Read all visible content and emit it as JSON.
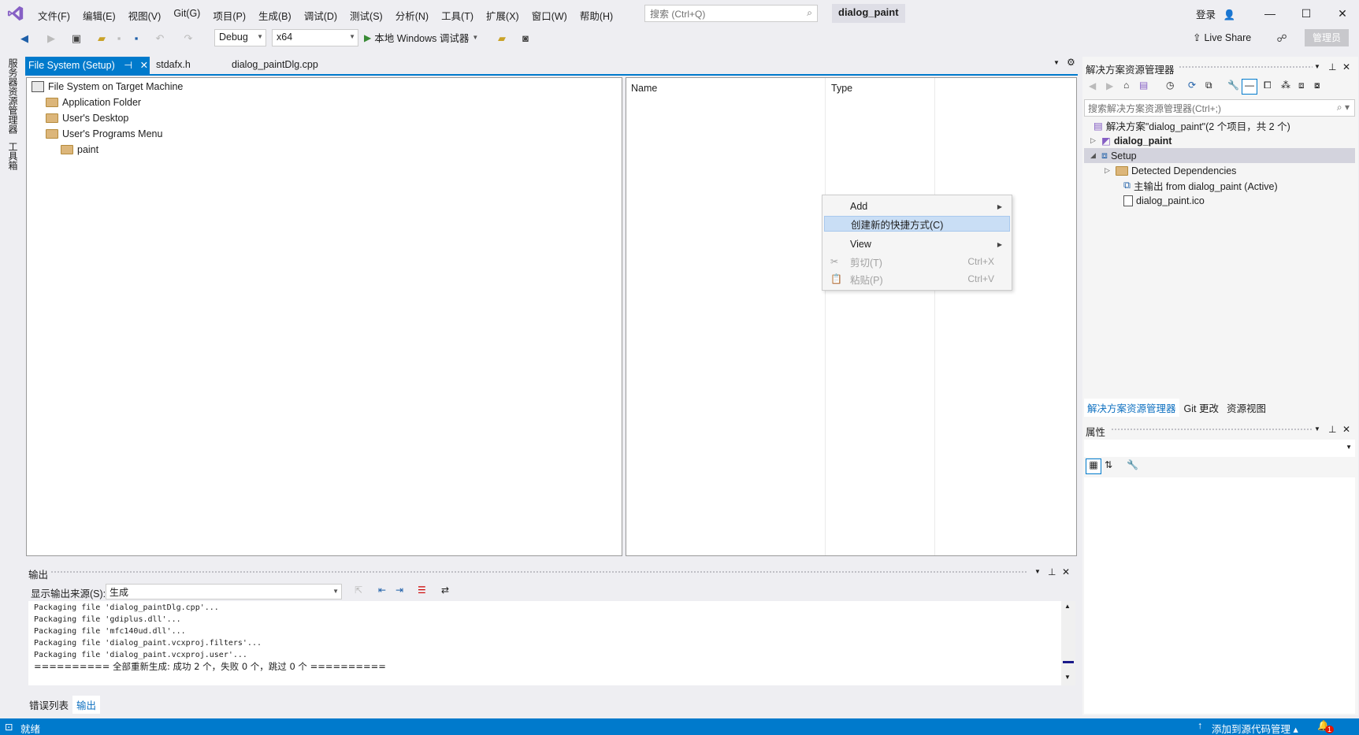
{
  "menu": {
    "items": [
      "文件(F)",
      "编辑(E)",
      "视图(V)",
      "Git(G)",
      "项目(P)",
      "生成(B)",
      "调试(D)",
      "测试(S)",
      "分析(N)",
      "工具(T)",
      "扩展(X)",
      "窗口(W)",
      "帮助(H)"
    ],
    "search_placeholder": "搜索 (Ctrl+Q)",
    "solution_name": "dialog_paint",
    "login": "登录"
  },
  "toolbar": {
    "config": "Debug",
    "platform": "x64",
    "run_label": "本地 Windows 调试器",
    "live_share": "Live Share",
    "admin": "管理员"
  },
  "left_strip": {
    "tab1": "服务器资源管理器",
    "tab2": "工具箱"
  },
  "doc_tabs": [
    "File System (Setup)",
    "stdafx.h",
    "dialog_paintDlg.cpp"
  ],
  "filesystem": {
    "root": "File System on Target Machine",
    "items": [
      "Application Folder",
      "User's Desktop",
      "User's Programs Menu"
    ],
    "subitem": "paint",
    "col_name": "Name",
    "col_type": "Type"
  },
  "context_menu": {
    "add": "Add",
    "create_shortcut": "创建新的快捷方式(C)",
    "view": "View",
    "cut": "剪切(T)",
    "cut_shortcut": "Ctrl+X",
    "paste": "粘贴(P)",
    "paste_shortcut": "Ctrl+V"
  },
  "output": {
    "title": "输出",
    "source_label": "显示输出来源(S):",
    "source_value": "生成",
    "lines": [
      "Packaging file 'dialog_paintDlg.cpp'...",
      "Packaging file 'gdiplus.dll'...",
      "Packaging file 'mfc140ud.dll'...",
      "Packaging file 'dialog_paint.vcxproj.filters'...",
      "Packaging file 'dialog_paint.vcxproj.user'...",
      "========== 全部重新生成: 成功 2 个，失败 0 个，跳过 0 个 =========="
    ],
    "tabs": [
      "错误列表",
      "输出"
    ]
  },
  "solution_explorer": {
    "title": "解决方案资源管理器",
    "search_placeholder": "搜索解决方案资源管理器(Ctrl+;)",
    "solution_line": "解决方案\"dialog_paint\"(2 个项目，共 2 个)",
    "project1": "dialog_paint",
    "project2": "Setup",
    "detected": "Detected Dependencies",
    "primary_output": "主输出 from dialog_paint (Active)",
    "icon_file": "dialog_paint.ico",
    "tabs": [
      "解决方案资源管理器",
      "Git 更改",
      "资源视图"
    ]
  },
  "properties": {
    "title": "属性"
  },
  "status": {
    "ready": "就绪",
    "source_control": "添加到源代码管理",
    "notif_count": "1"
  },
  "colors": {
    "accent": "#007acc",
    "chrome": "#eeeef2",
    "highlight": "#c9def5"
  }
}
